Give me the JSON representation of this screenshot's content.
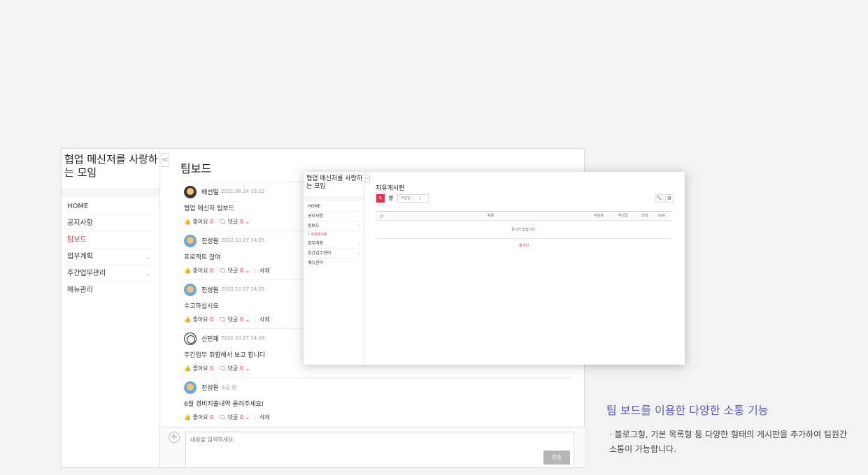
{
  "colors": {
    "accent": "#e1304a",
    "feature_title": "#5b5bb5"
  },
  "main": {
    "workspace_title": "협업 메신저를 사랑하는 모임",
    "collapse_icon": "<",
    "board_title": "팀보드",
    "sidebar": {
      "items": [
        {
          "label": "HOME",
          "active": false,
          "has_children": false
        },
        {
          "label": "공지사항",
          "active": false,
          "has_children": false
        },
        {
          "label": "팀보드",
          "active": true,
          "has_children": false
        },
        {
          "label": "업무계획",
          "active": false,
          "has_children": true
        },
        {
          "label": "주간업무관리",
          "active": false,
          "has_children": true
        },
        {
          "label": "메뉴관리",
          "active": false,
          "has_children": false
        }
      ],
      "chevron": "⌄"
    },
    "posts": [
      {
        "author": "배선일",
        "time": "2021.08.24 15:12",
        "content": "협업 메신저 팀보드",
        "like_label": "좋아요",
        "likes": "0",
        "comment_label": "댓글",
        "comments": "0",
        "comment_caret": "⌄",
        "delete_label": ""
      },
      {
        "author": "진성원",
        "time": "2022.10.27 14:25",
        "content": "프로젝트 참여",
        "like_label": "좋아요",
        "likes": "0",
        "comment_label": "댓글",
        "comments": "0",
        "comment_caret": "⌄",
        "delete_label": "삭제"
      },
      {
        "author": "진성원",
        "time": "2022.10.27 14:25",
        "content": "수고하십시요",
        "like_label": "좋아요",
        "likes": "0",
        "comment_label": "댓글",
        "comments": "0",
        "comment_caret": "⌄",
        "delete_label": "삭제"
      },
      {
        "author": "신민재",
        "time": "2022.10.27 14:28",
        "content": "주간업무 취합해서 보고 합니다",
        "like_label": "좋아요",
        "likes": "0",
        "comment_label": "댓글",
        "comments": "0",
        "comment_caret": "⌄",
        "delete_label": ""
      },
      {
        "author": "진성원",
        "time": "조금 전",
        "content": "6월 경비지출내역 올려주세요!",
        "like_label": "좋아요",
        "likes": "0",
        "comment_label": "댓글",
        "comments": "0",
        "comment_caret": "⌄",
        "delete_label": "삭제"
      }
    ],
    "composer": {
      "add_icon": "+",
      "placeholder": "내용을 입력하세요.",
      "send_label": "전송"
    }
  },
  "overlay": {
    "workspace_title": "협업 메신저를 사랑하는 모임",
    "collapse_icon": "<",
    "board_title": "자유게시판",
    "sidebar": {
      "items": [
        {
          "label": "HOME"
        },
        {
          "label": "공지사항"
        },
        {
          "label": "팀보드"
        },
        {
          "label": "자유게시판"
        },
        {
          "label": "업무계획"
        },
        {
          "label": "주간업무관리"
        },
        {
          "label": "메뉴관리"
        }
      ],
      "chevron": "⌄",
      "sub_bullet": "•"
    },
    "toolbar": {
      "write_icon": "✎",
      "trash_icon": "🗑",
      "sort_label": "작성일",
      "sort_caret": "⌄",
      "sort_dir": "↓",
      "search_icon": "🔍",
      "gear_icon": "⚙"
    },
    "table": {
      "columns": [
        "제목",
        "작성자",
        "작성일",
        "조회",
        "Like"
      ],
      "empty_message": "문서가 없습니다."
    },
    "pager": "총 0건"
  },
  "feature": {
    "title": "팀 보드를 이용한 다양한 소통 기능",
    "description": "· 블로그형, 기본 목록형 등 다양한 형태의 게시판을 추가하여 팀원간 소통이 가능합니다."
  }
}
